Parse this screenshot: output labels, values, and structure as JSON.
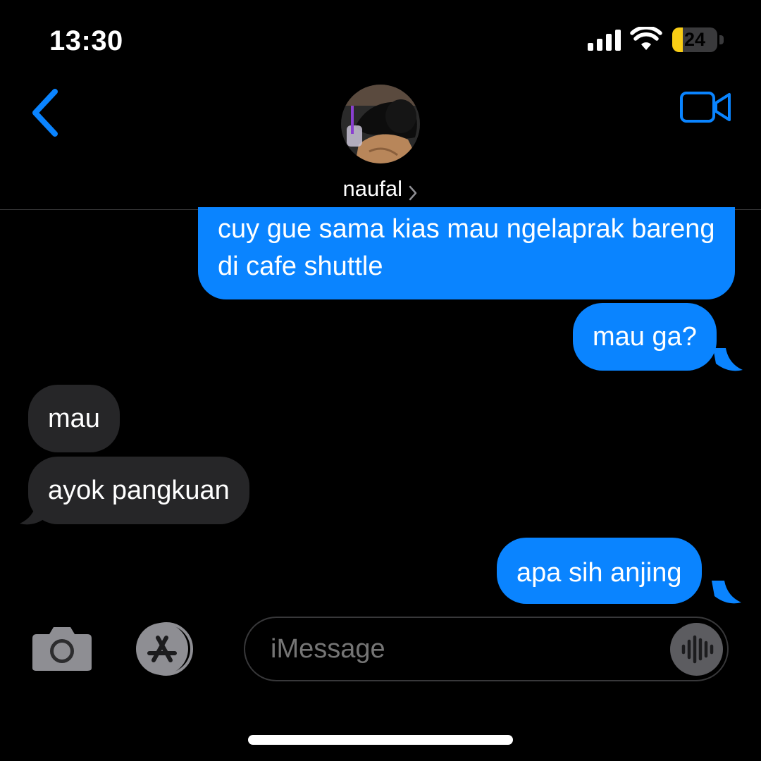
{
  "status_bar": {
    "time": "13:30",
    "battery_level": "24",
    "battery_color": "#f9cd15"
  },
  "header": {
    "contact_name": "naufal",
    "back_icon": "chevron-left-icon",
    "video_icon": "video-camera-icon",
    "accent_color": "#0a84ff"
  },
  "messages": [
    {
      "direction": "sent",
      "text": "cuy gue sama kias mau ngelaprak bareng di cafe shuttle"
    },
    {
      "direction": "sent",
      "text": "mau ga?"
    },
    {
      "direction": "received",
      "text": "mau"
    },
    {
      "direction": "received",
      "text": "ayok pangkuan"
    },
    {
      "direction": "sent",
      "text": "apa sih anjing"
    }
  ],
  "input_bar": {
    "placeholder": "iMessage",
    "camera_icon": "camera-icon",
    "apps_icon": "app-store-icon",
    "audio_icon": "waveform-icon"
  },
  "colors": {
    "sent_bubble": "#0a84ff",
    "received_bubble": "#262628",
    "background": "#000000"
  }
}
